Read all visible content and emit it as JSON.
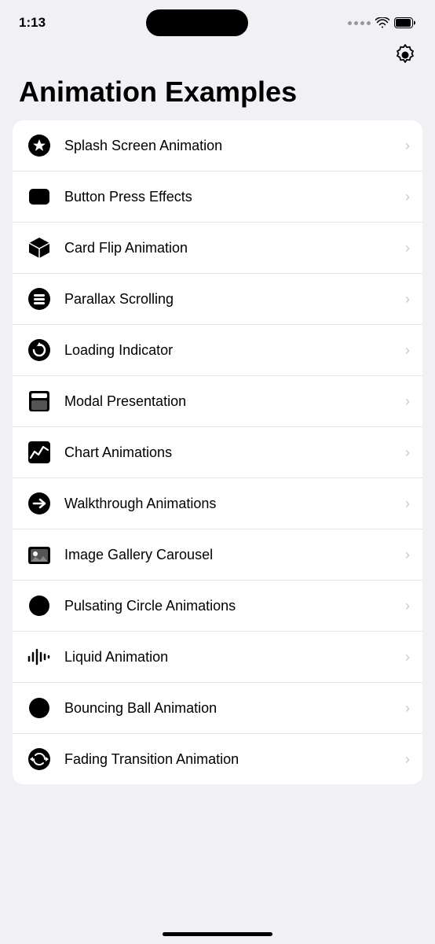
{
  "statusBar": {
    "time": "1:13",
    "centerPill": true
  },
  "header": {
    "title": "Animation Examples",
    "settingsLabel": "settings"
  },
  "list": {
    "items": [
      {
        "id": "splash-screen",
        "label": "Splash Screen Animation",
        "icon": "star-circle-icon"
      },
      {
        "id": "button-press",
        "label": "Button Press Effects",
        "icon": "rounded-rect-icon"
      },
      {
        "id": "card-flip",
        "label": "Card Flip Animation",
        "icon": "cube-icon"
      },
      {
        "id": "parallax-scrolling",
        "label": "Parallax Scrolling",
        "icon": "list-icon"
      },
      {
        "id": "loading-indicator",
        "label": "Loading Indicator",
        "icon": "refresh-circle-icon"
      },
      {
        "id": "modal-presentation",
        "label": "Modal Presentation",
        "icon": "modal-icon"
      },
      {
        "id": "chart-animations",
        "label": "Chart Animations",
        "icon": "chart-icon"
      },
      {
        "id": "walkthrough-animations",
        "label": "Walkthrough Animations",
        "icon": "arrow-circle-icon"
      },
      {
        "id": "image-gallery",
        "label": "Image Gallery Carousel",
        "icon": "gallery-icon"
      },
      {
        "id": "pulsating-circle",
        "label": "Pulsating Circle Animations",
        "icon": "circle-icon"
      },
      {
        "id": "liquid-animation",
        "label": "Liquid Animation",
        "icon": "waveform-icon"
      },
      {
        "id": "bouncing-ball",
        "label": "Bouncing Ball Animation",
        "icon": "ball-icon"
      },
      {
        "id": "fading-transition",
        "label": "Fading Transition Animation",
        "icon": "sync-circle-icon"
      }
    ]
  }
}
